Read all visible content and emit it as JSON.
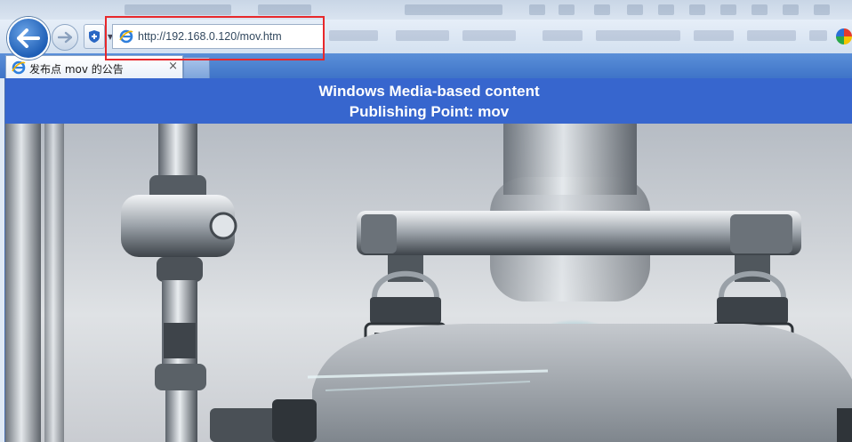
{
  "browser": {
    "address_url": "http://192.168.0.120/mov.htm",
    "tab_title": "发布点 mov 的公告",
    "tab_close": "×",
    "back_icon": "back-arrow-icon",
    "forward_icon": "forward-arrow-icon",
    "highlight_color": "#e8282b"
  },
  "content": {
    "banner_line1": "Windows Media-based content",
    "banner_line2": "Publishing Point: mov",
    "banner_color": "#3766ce",
    "image_subject": "metallic robotic machinery photo"
  }
}
